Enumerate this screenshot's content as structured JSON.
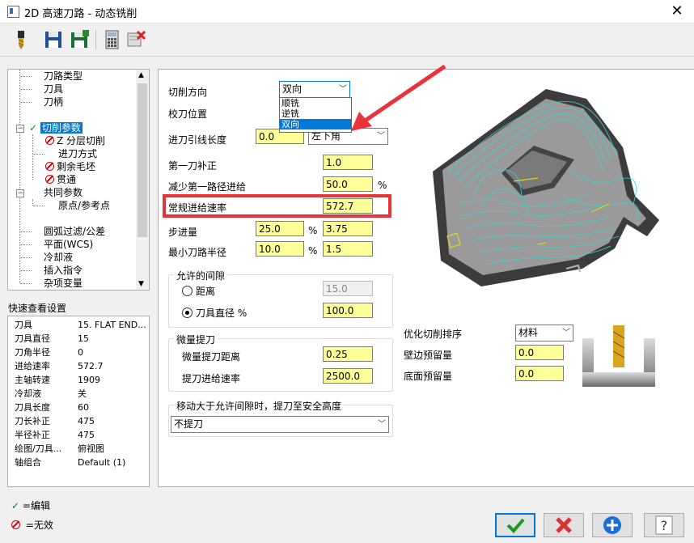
{
  "window": {
    "title": "2D 高速刀路 - 动态铣削",
    "close_label": "✕"
  },
  "toolbar": {
    "icons": [
      "tool-icon",
      "save-icon",
      "save-all-icon",
      "calculator-icon",
      "delete-icon"
    ]
  },
  "tree": {
    "items": [
      {
        "label": "刀路类型"
      },
      {
        "label": "刀具"
      },
      {
        "label": "刀柄"
      },
      {
        "label": "切削参数"
      },
      {
        "label": "Z 分层切削"
      },
      {
        "label": "进刀方式"
      },
      {
        "label": "剩余毛坯"
      },
      {
        "label": "贯通"
      },
      {
        "label": "共同参数"
      },
      {
        "label": "原点/参考点"
      },
      {
        "label": "圆弧过滤/公差"
      },
      {
        "label": "平面(WCS)"
      },
      {
        "label": "冷却液"
      },
      {
        "label": "插入指令"
      },
      {
        "label": "杂项变量"
      }
    ]
  },
  "quick_view": {
    "title": "快速查看设置",
    "rows": [
      {
        "k": "刀具",
        "v": "15. FLAT END..."
      },
      {
        "k": "刀具直径",
        "v": "15"
      },
      {
        "k": "刀角半径",
        "v": "0"
      },
      {
        "k": "进给速率",
        "v": "572.7"
      },
      {
        "k": "主轴转速",
        "v": "1909"
      },
      {
        "k": "冷却液",
        "v": "关"
      },
      {
        "k": "刀具长度",
        "v": "60"
      },
      {
        "k": "刀长补正",
        "v": "475"
      },
      {
        "k": "半径补正",
        "v": "475"
      },
      {
        "k": "绘图/刀具...",
        "v": "俯视图"
      },
      {
        "k": "轴组合",
        "v": "Default (1)"
      }
    ]
  },
  "legend": {
    "edit": "=编辑",
    "invalid": "=无效"
  },
  "form": {
    "cut_direction_label": "切削方向",
    "cut_direction_value": "双向",
    "cut_direction_options": [
      "顺铣",
      "逆铣",
      "双向"
    ],
    "tool_pos_label": "校刀位置",
    "lead_in_label": "进刀引线长度",
    "lead_in_value": "0.0",
    "lead_in_corner": "左下角",
    "first_pass_label": "第一刀补正",
    "first_pass_value": "1.0",
    "reduce_first_label": "减少第一路径进给",
    "reduce_first_value": "50.0",
    "reduce_first_unit": "%",
    "feed_label": "常规进给速率",
    "feed_value": "572.7",
    "stepover_label": "步进量",
    "stepover_pct": "25.0",
    "stepover_pct_unit": "%",
    "stepover_value": "3.75",
    "min_radius_label": "最小刀路半径",
    "min_radius_pct": "10.0",
    "min_radius_unit": "%",
    "min_radius_value": "1.5",
    "gap_group_title": "允许的间隙",
    "gap_distance_label": "距离",
    "gap_distance_value": "15.0",
    "gap_tooldia_label": "刀具直径 %",
    "gap_tooldia_value": "100.0",
    "micro_group_title": "微量提刀",
    "micro_dist_label": "微量提刀距离",
    "micro_dist_value": "0.25",
    "micro_feed_label": "提刀进给速率",
    "micro_feed_value": "2500.0",
    "move_group_title": "移动大于允许间隙时，提刀至安全高度",
    "move_value": "不提刀",
    "optimize_label": "优化切削排序",
    "optimize_value": "材料",
    "wall_stock_label": "壁边预留量",
    "wall_stock_value": "0.0",
    "floor_stock_label": "底面预留量",
    "floor_stock_value": "0.0"
  },
  "colors": {
    "input_bg": "#ffff99",
    "highlight": "#0078d7",
    "annotation": "#e8333a",
    "toolpath": "#35d4d4"
  },
  "buttons": [
    "ok-button",
    "cancel-button",
    "add-button",
    "help-button"
  ]
}
